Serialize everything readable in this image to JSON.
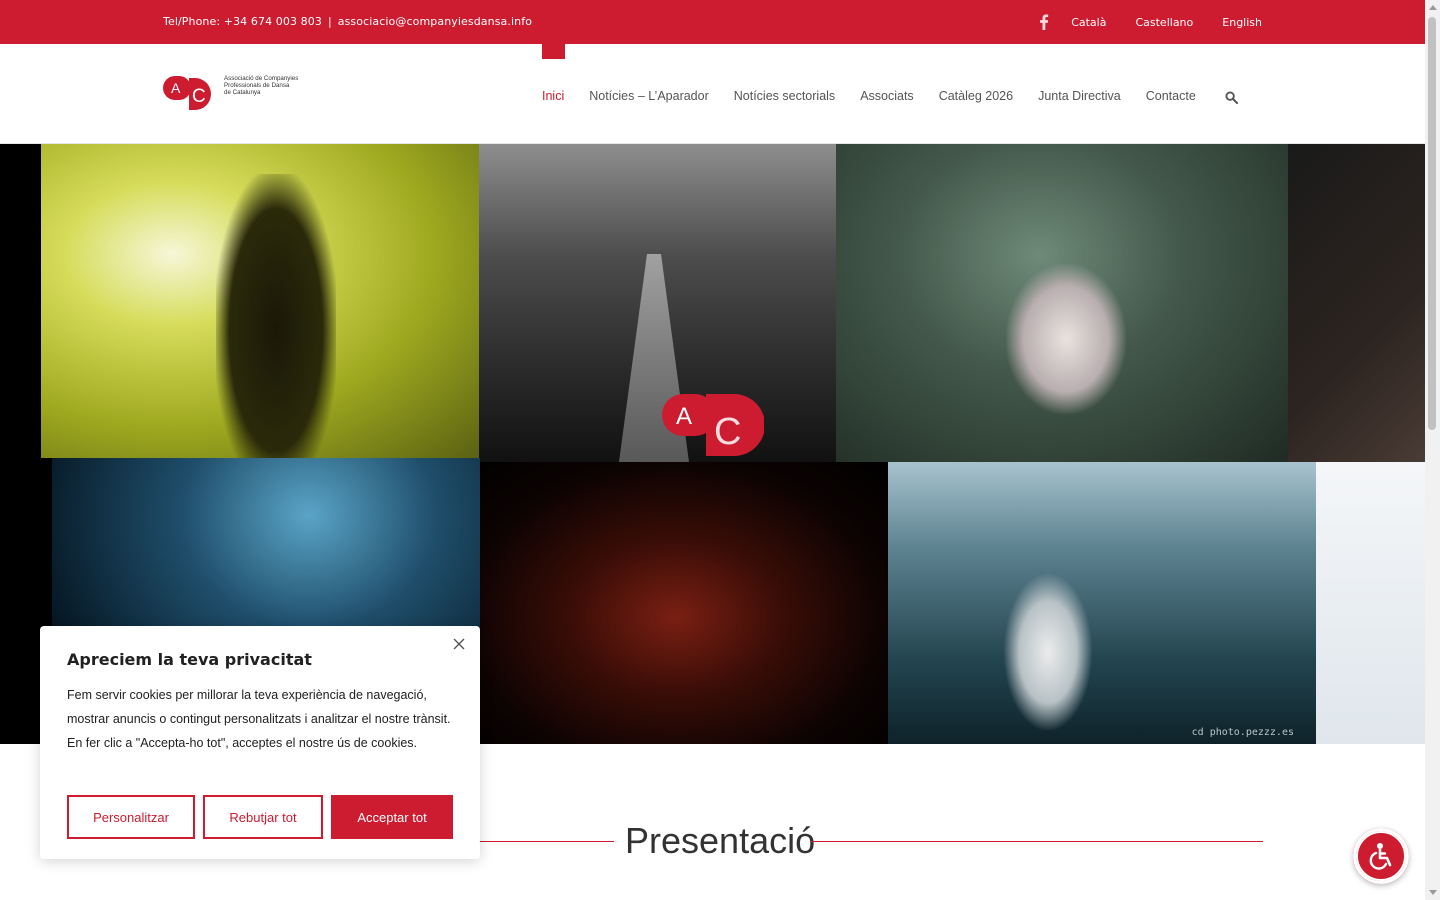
{
  "topbar": {
    "phone": "Tel/Phone: +34 674 003 803",
    "separator": "|",
    "email": "associacio@companyiesdansa.info",
    "languages": [
      "Català",
      "Castellano",
      "English"
    ]
  },
  "header": {
    "logo_text": [
      "Associació de Companyies",
      "Professionals de Dansa",
      "de Catalunya"
    ],
    "nav": [
      "Inici",
      "Notícies – L’Aparador",
      "Notícies sectorials",
      "Associats",
      "Catàleg 2026",
      "Junta Directiva",
      "Contacte"
    ]
  },
  "hero": {
    "credit": "cd photo.pezzz.es"
  },
  "presentation": {
    "title": "Presentació"
  },
  "cookie": {
    "title": "Apreciem la teva privacitat",
    "text": "Fem servir cookies per millorar la teva experiència de navegació, mostrar anuncis o contingut personalitzats i analitzar el nostre trànsit. En fer clic a \"Accepta-ho tot\", acceptes el nostre ús de cookies.",
    "buttons": [
      "Personalitzar",
      "Rebutjar tot",
      "Acceptar tot"
    ]
  },
  "colors": {
    "brand": "#cd1b30"
  }
}
